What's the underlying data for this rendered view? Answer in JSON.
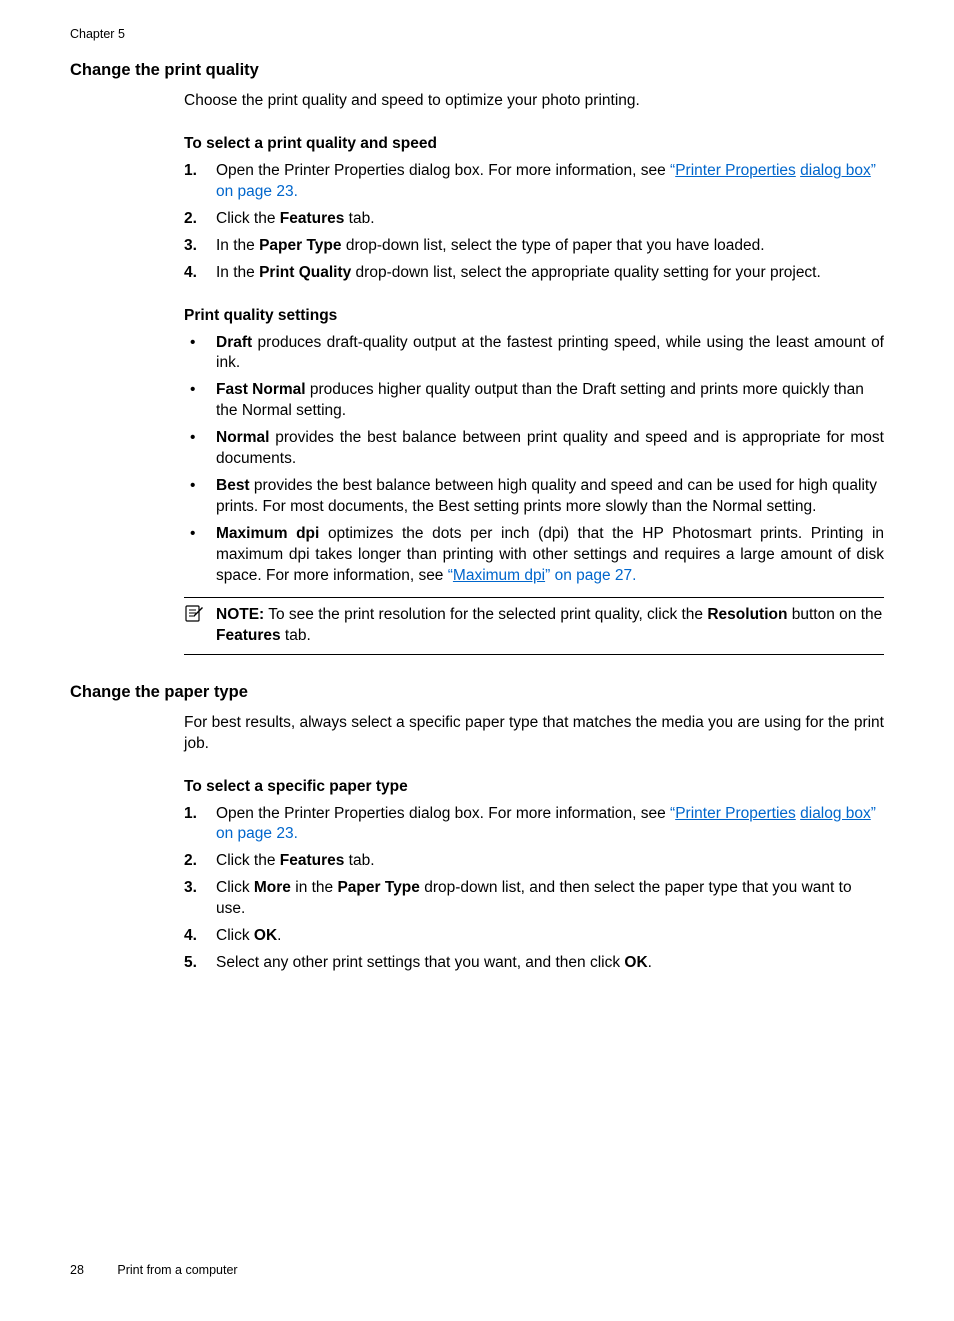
{
  "chapter": "Chapter 5",
  "section1": {
    "title": "Change the print quality",
    "intro": "Choose the print quality and speed to optimize your photo printing.",
    "procTitle": "To select a print quality and speed",
    "step1_pre": "Open the Printer Properties dialog box. For more information, see ",
    "step1_q1": "“",
    "step1_link1": "Printer Properties",
    "step1_link2": "dialog box",
    "step1_q2": "”",
    "step1_post": " on page 23.",
    "step2_a": "Click the ",
    "step2_b": "Features",
    "step2_c": " tab.",
    "step3_a": "In the ",
    "step3_b": "Paper Type",
    "step3_c": " drop-down list, select the type of paper that you have loaded.",
    "step4_a": "In the ",
    "step4_b": "Print Quality",
    "step4_c": " drop-down list, select the appropriate quality setting for your project.",
    "settingsTitle": "Print quality settings",
    "b1_b": "Draft",
    "b1_t": " produces draft-quality output at the fastest printing speed, while using the least amount of ink.",
    "b2_b": "Fast Normal",
    "b2_t": " produces higher quality output than the Draft setting and prints more quickly than the Normal setting.",
    "b3_b": "Normal",
    "b3_t": " provides the best balance between print quality and speed and is appropriate for most documents.",
    "b4_b": "Best",
    "b4_t": " provides the best balance between high quality and speed and can be used for high quality prints. For most documents, the Best setting prints more slowly than the Normal setting.",
    "b5_b": "Maximum dpi",
    "b5_t1": " optimizes the dots per inch (dpi) that the HP Photosmart prints. Printing in maximum dpi takes longer than printing with other settings and requires a large amount of disk space. For more information, see ",
    "b5_q1": "“",
    "b5_link": "Maximum dpi",
    "b5_q2": "”",
    "b5_t2": " on page 27.",
    "note_label": "NOTE:",
    "note_t1": "  To see the print resolution for the selected print quality, click the ",
    "note_b1": "Resolution",
    "note_t2": " button on the ",
    "note_b2": "Features",
    "note_t3": " tab."
  },
  "section2": {
    "title": "Change the paper type",
    "intro": "For best results, always select a specific paper type that matches the media you are using for the print job.",
    "procTitle": "To select a specific paper type",
    "step1_pre": "Open the Printer Properties dialog box. For more information, see ",
    "step1_q1": "“",
    "step1_link1": "Printer Properties",
    "step1_link2": "dialog box",
    "step1_q2": "”",
    "step1_post": " on page 23.",
    "step2_a": "Click the ",
    "step2_b": "Features",
    "step2_c": " tab.",
    "step3_a": "Click ",
    "step3_b1": "More",
    "step3_c": " in the ",
    "step3_b2": "Paper Type",
    "step3_d": " drop-down list, and then select the paper type that you want to use.",
    "step4_a": "Click ",
    "step4_b": "OK",
    "step4_c": ".",
    "step5_a": "Select any other print settings that you want, and then click ",
    "step5_b": "OK",
    "step5_c": "."
  },
  "footer": {
    "pageNum": "28",
    "title": "Print from a computer"
  }
}
